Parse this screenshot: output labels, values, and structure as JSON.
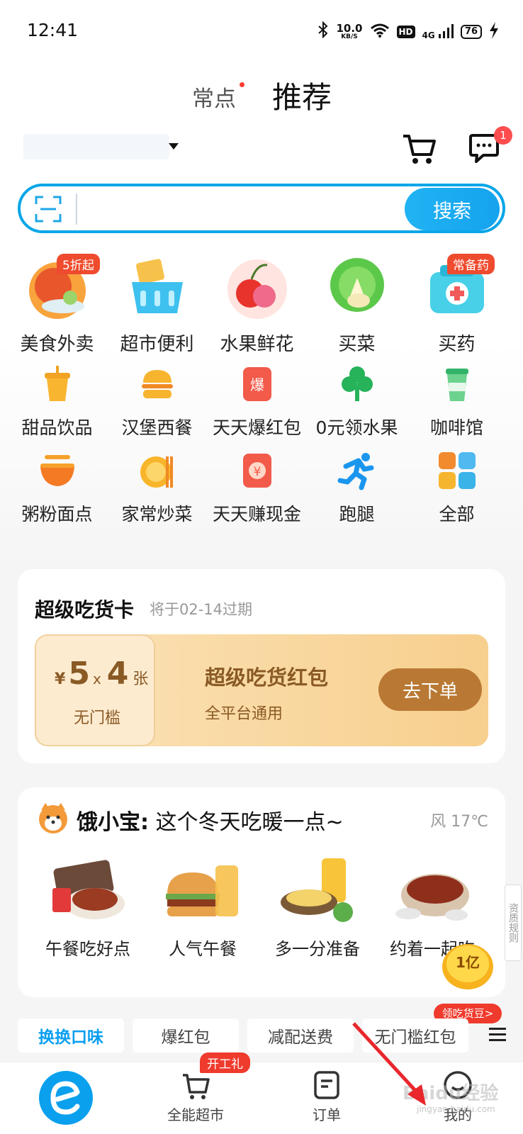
{
  "status_bar": {
    "time": "12:41",
    "net_speed_value": "10.0",
    "net_speed_unit": "KB/S",
    "hd": "HD",
    "net_type": "4G",
    "battery": "76"
  },
  "top_tabs": {
    "tab1": "常点",
    "tab2": "推荐"
  },
  "header": {
    "message_badge": "1"
  },
  "search": {
    "button": "搜索",
    "placeholder": ""
  },
  "categories": {
    "row1": [
      {
        "label": "美食外卖",
        "badge": "5折起",
        "icon": "food-bowl-icon"
      },
      {
        "label": "超市便利",
        "badge": "",
        "icon": "shopping-basket-icon"
      },
      {
        "label": "水果鲜花",
        "badge": "",
        "icon": "cherry-flower-icon"
      },
      {
        "label": "买菜",
        "badge": "",
        "icon": "vegetable-icon"
      },
      {
        "label": "买药",
        "badge": "常备药",
        "icon": "medicine-box-icon"
      }
    ],
    "row2": [
      {
        "label": "甜品饮品",
        "icon": "drink-cup-icon"
      },
      {
        "label": "汉堡西餐",
        "icon": "burger-icon"
      },
      {
        "label": "天天爆红包",
        "icon": "red-envelope-icon",
        "glyph": "爆"
      },
      {
        "label": "0元领水果",
        "icon": "tree-icon"
      },
      {
        "label": "咖啡馆",
        "icon": "coffee-cup-icon"
      }
    ],
    "row3": [
      {
        "label": "粥粉面点",
        "icon": "noodle-bowl-icon"
      },
      {
        "label": "家常炒菜",
        "icon": "plate-chopsticks-icon"
      },
      {
        "label": "天天赚现金",
        "icon": "cash-envelope-icon",
        "glyph": "¥"
      },
      {
        "label": "跑腿",
        "icon": "runner-icon"
      },
      {
        "label": "全部",
        "icon": "grid-all-icon"
      }
    ]
  },
  "super_card": {
    "title": "超级吃货卡",
    "expire": "将于02-14过期",
    "coupon": {
      "yen": "¥",
      "amount": "5",
      "times": "x",
      "count": "4",
      "unit": "张",
      "threshold": "无门槛",
      "title": "超级吃货红包",
      "subtitle": "全平台通用",
      "button": "去下单"
    }
  },
  "ele_card": {
    "headline_name": "饿小宝:",
    "headline_text": "这个冬天吃暖一点~",
    "weather": "风 17℃",
    "items": [
      {
        "label": "午餐吃好点"
      },
      {
        "label": "人气午餐"
      },
      {
        "label": "多一分准备"
      },
      {
        "label": "约着一起吃"
      }
    ]
  },
  "side_tag": "资质规则",
  "float_beans": {
    "amount": "1亿",
    "label": "领吃货豆>"
  },
  "filter_tabs": [
    "换换口味",
    "爆红包",
    "减配送费",
    "无门槛红包"
  ],
  "bottom_nav": {
    "supermarket": "全能超市",
    "supermarket_badge": "开工礼",
    "orders": "订单",
    "mine": "我的"
  },
  "watermark": {
    "text": "Baidu经验",
    "sub": "jingyan.baidu.com"
  },
  "colors": {
    "brand_blue": "#0aa0ee",
    "badge_red": "#ef4b2e",
    "coupon_brown": "#8a5a25"
  }
}
